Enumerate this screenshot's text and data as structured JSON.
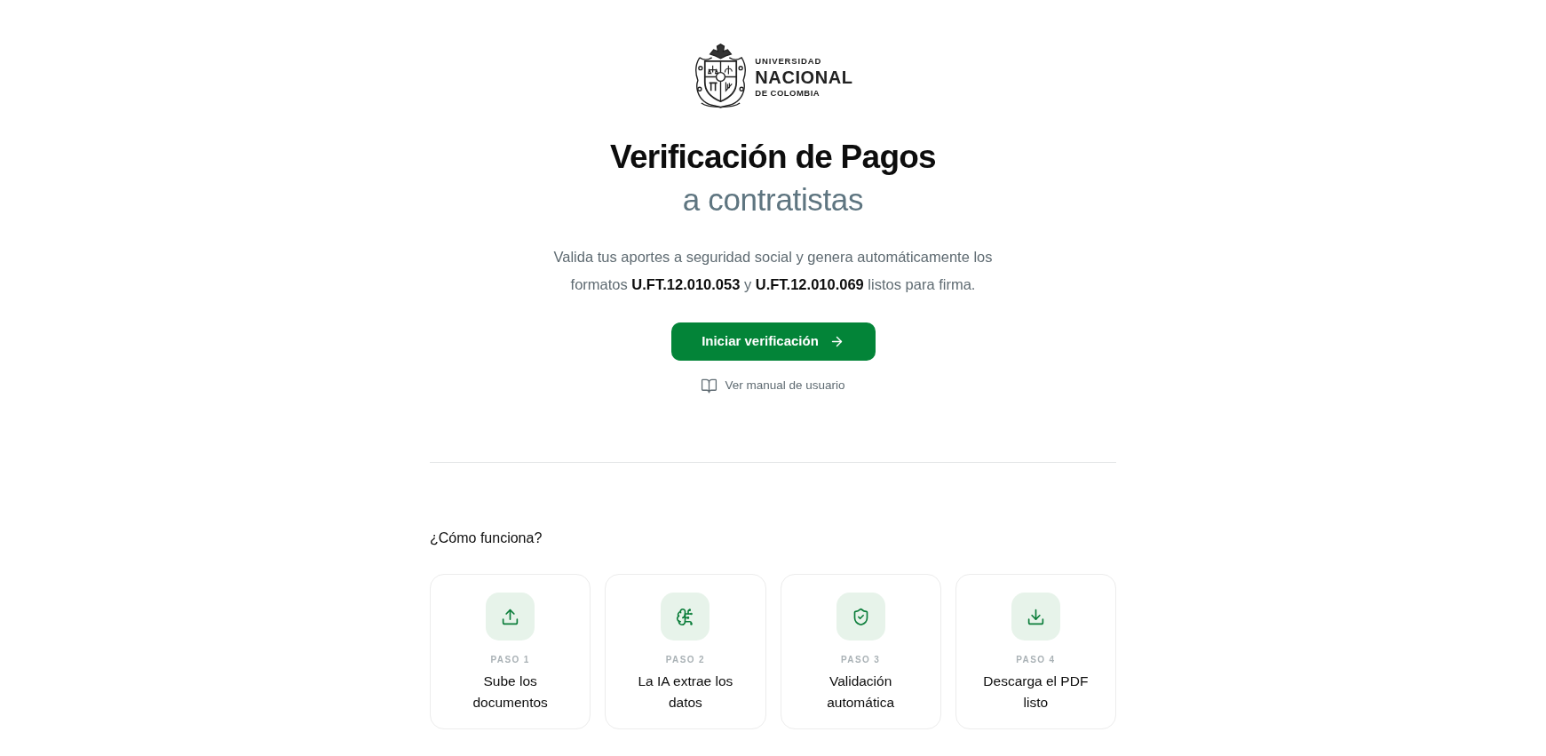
{
  "logo": {
    "top": "UNIVERSIDAD",
    "name": "NACIONAL",
    "bottom": "DE COLOMBIA"
  },
  "hero": {
    "title": "Verificación de Pagos",
    "subtitle": "a contratistas",
    "description": "Valida tus aportes a seguridad social y genera automáticamente los formatos **U.FT.12.010.053** y **U.FT.12.010.069** listos para firma.",
    "primary_button": "Iniciar verificación",
    "manual_link": "Ver manual de usuario"
  },
  "how_it_works": {
    "heading": "¿Cómo funciona?",
    "steps": [
      {
        "kind": "upload",
        "step": "PASO 1",
        "title": "Sube los documentos"
      },
      {
        "kind": "ai",
        "step": "PASO 2",
        "title": "La IA extrae los datos"
      },
      {
        "kind": "verify",
        "step": "PASO 3",
        "title": "Validación automática"
      },
      {
        "kind": "download",
        "step": "PASO 4",
        "title": "Descarga el PDF listo"
      }
    ]
  }
}
